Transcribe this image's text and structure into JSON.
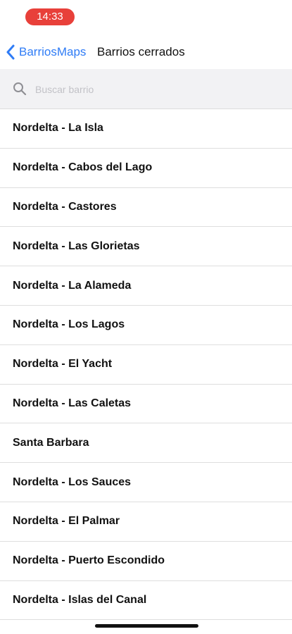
{
  "status": {
    "time": "14:33"
  },
  "nav": {
    "back_label": "BarriosMaps",
    "title": "Barrios cerrados"
  },
  "search": {
    "placeholder": "Buscar barrio",
    "value": ""
  },
  "items": [
    "Nordelta - La Isla",
    "Nordelta - Cabos del Lago",
    "Nordelta - Castores",
    "Nordelta - Las Glorietas",
    "Nordelta - La Alameda",
    "Nordelta - Los Lagos",
    "Nordelta - El Yacht",
    "Nordelta - Las Caletas",
    "Santa Barbara",
    "Nordelta - Los Sauces",
    "Nordelta - El Palmar",
    "Nordelta - Puerto Escondido",
    "Nordelta - Islas del Canal"
  ],
  "colors": {
    "accent": "#2f7cf6",
    "time_pill": "#e8403a"
  }
}
